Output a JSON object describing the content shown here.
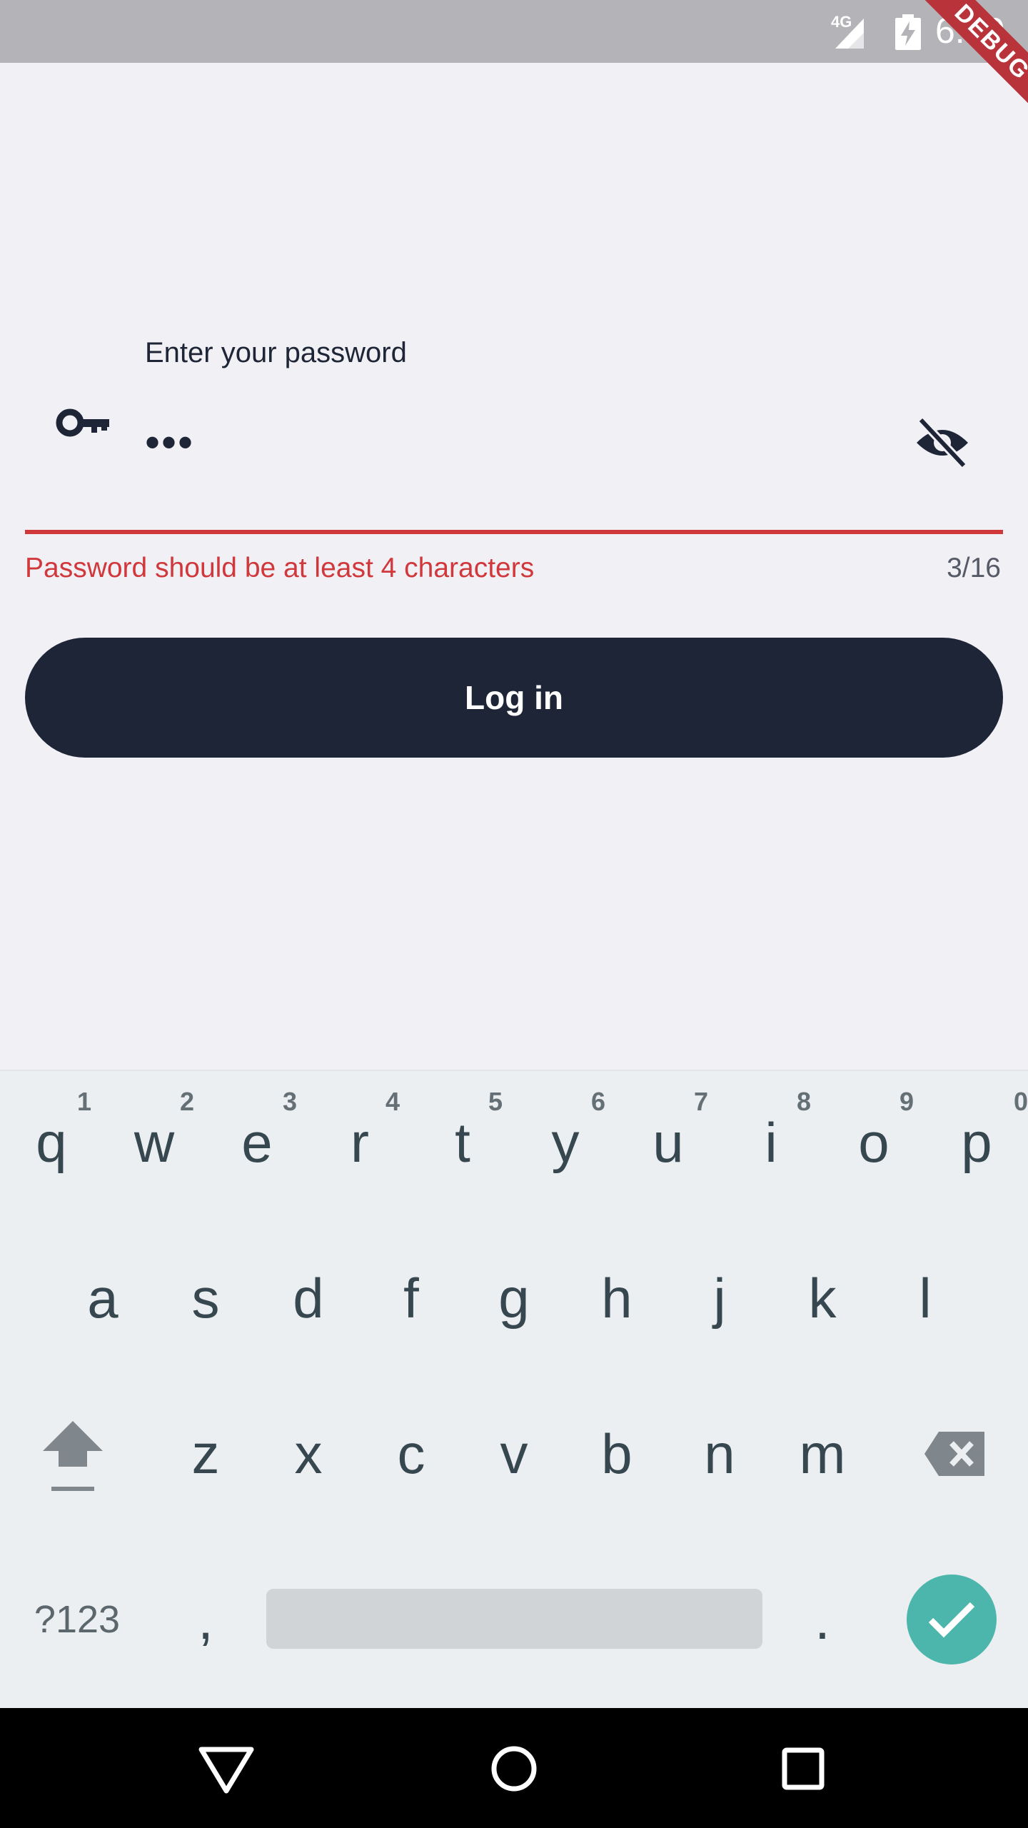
{
  "status_bar": {
    "network_label": "4G",
    "time": "6:50"
  },
  "debug_banner": "DEBUG",
  "password_field": {
    "label": "Enter your password",
    "value": "•••",
    "leading_icon": "key-icon",
    "trailing_icon": "visibility-off-icon",
    "error": "Password should be at least 4 characters",
    "counter": "3/16",
    "error_color": "#d0383c"
  },
  "login_button": {
    "label": "Log in",
    "color": "#1e2536"
  },
  "keyboard": {
    "row1": [
      {
        "key": "q",
        "hint": "1"
      },
      {
        "key": "w",
        "hint": "2"
      },
      {
        "key": "e",
        "hint": "3"
      },
      {
        "key": "r",
        "hint": "4"
      },
      {
        "key": "t",
        "hint": "5"
      },
      {
        "key": "y",
        "hint": "6"
      },
      {
        "key": "u",
        "hint": "7"
      },
      {
        "key": "i",
        "hint": "8"
      },
      {
        "key": "o",
        "hint": "9"
      },
      {
        "key": "p",
        "hint": "0"
      }
    ],
    "row2": [
      "a",
      "s",
      "d",
      "f",
      "g",
      "h",
      "j",
      "k",
      "l"
    ],
    "row3": [
      "z",
      "x",
      "c",
      "v",
      "b",
      "n",
      "m"
    ],
    "symbols_label": "?123",
    "comma": ",",
    "period": ".",
    "enter_color": "#4db6ac"
  },
  "nav_bar": {
    "back_icon": "back-triangle-icon",
    "home_icon": "home-circle-icon",
    "recents_icon": "recents-square-icon"
  }
}
